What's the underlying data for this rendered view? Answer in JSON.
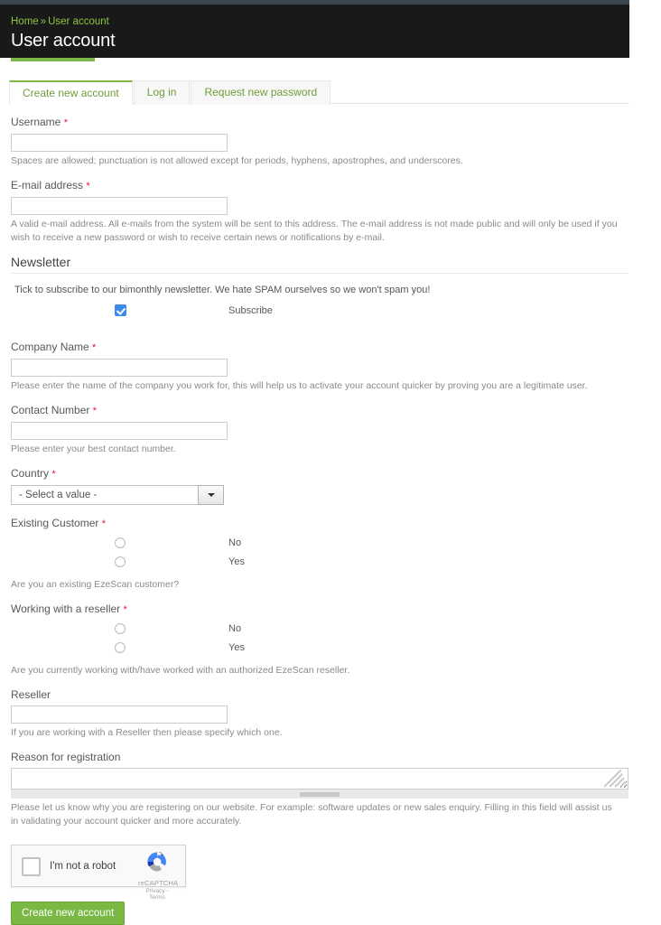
{
  "header": {
    "breadcrumb": {
      "home": "Home",
      "separator": "»",
      "current": "User account"
    },
    "title": "User account"
  },
  "tabs": [
    {
      "label": "Create new account",
      "active": true
    },
    {
      "label": "Log in",
      "active": false
    },
    {
      "label": "Request new password",
      "active": false
    }
  ],
  "form": {
    "username": {
      "label": "Username",
      "required_mark": "*",
      "value": "",
      "description": "Spaces are allowed; punctuation is not allowed except for periods, hyphens, apostrophes, and underscores."
    },
    "email": {
      "label": "E-mail address",
      "required_mark": "*",
      "value": "",
      "description": "A valid e-mail address. All e-mails from the system will be sent to this address. The e-mail address is not made public and will only be used if you wish to receive a new password or wish to receive certain news or notifications by e-mail."
    },
    "newsletter": {
      "heading": "Newsletter",
      "intro": "Tick to subscribe to our bimonthly newsletter. We hate SPAM ourselves so we won't spam you!",
      "subscribe_label": "Subscribe",
      "subscribe_checked": true
    },
    "company_name": {
      "label": "Company Name",
      "required_mark": "*",
      "value": "",
      "description": "Please enter the name of the company you work for, this will help us to activate your account quicker by proving you are a legitimate user."
    },
    "contact_number": {
      "label": "Contact Number",
      "required_mark": "*",
      "value": "",
      "description": "Please enter your best contact number."
    },
    "country": {
      "label": "Country",
      "required_mark": "*",
      "selected": "- Select a value -"
    },
    "existing_customer": {
      "label": "Existing Customer",
      "required_mark": "*",
      "options": [
        {
          "label": "No",
          "selected": false
        },
        {
          "label": "Yes",
          "selected": false
        }
      ],
      "description": "Are you an existing EzeScan customer?"
    },
    "working_with_reseller": {
      "label": "Working with a reseller",
      "required_mark": "*",
      "options": [
        {
          "label": "No",
          "selected": false
        },
        {
          "label": "Yes",
          "selected": false
        }
      ],
      "description": "Are you currently working with/have worked with an authorized EzeScan reseller."
    },
    "reseller": {
      "label": "Reseller",
      "value": "",
      "description": "If you are working with a Reseller then please specify which one."
    },
    "reason": {
      "label": "Reason for registration",
      "value": "",
      "description": "Please let us know why you are registering on our website. For example: software updates or new sales enquiry. Filling in this field will assist us in validating your account quicker and more accurately."
    },
    "recaptcha": {
      "checkbox_label": "I'm not a robot",
      "brand": "reCAPTCHA",
      "links": "Privacy - Terms",
      "checked": false
    },
    "submit_label": "Create new account"
  },
  "colors": {
    "accent_green": "#7ab648",
    "header_dark": "#191919",
    "required_red": "#e8112d",
    "checkbox_blue": "#3b8beb"
  }
}
